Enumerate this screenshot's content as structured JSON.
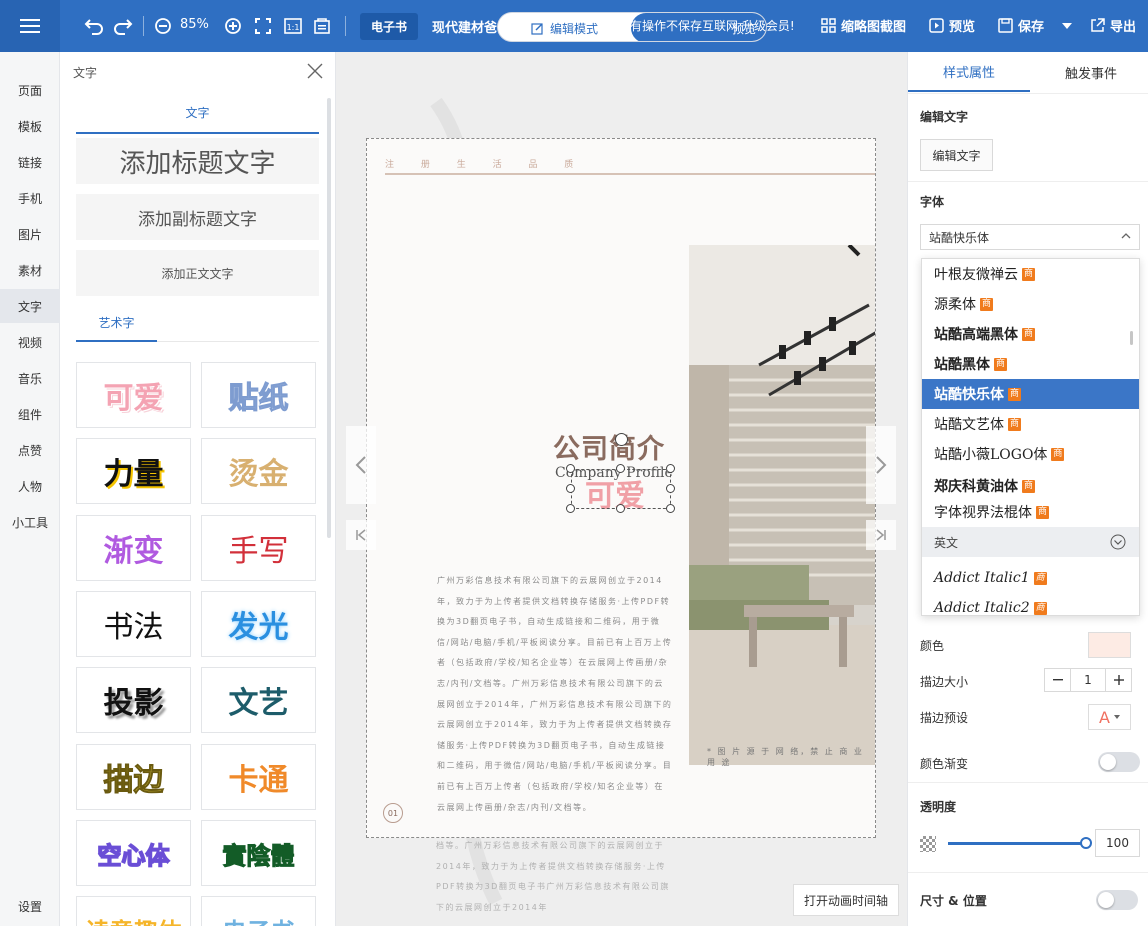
{
  "topbar": {
    "zoom": "85%",
    "tab_ebook": "电子书",
    "doc_title": "现代建材爸",
    "pill_left": "编辑模式",
    "pill_right": "预览",
    "promo": "有操作不保存互联网 升级会员!",
    "thumb_action": "缩略图截图",
    "preview_action": "预览",
    "save_action": "保存",
    "export_action": "导出"
  },
  "leftnav": {
    "items": [
      "页面",
      "模板",
      "链接",
      "手机",
      "图片",
      "素材",
      "文字",
      "视频",
      "音乐",
      "组件",
      "点赞",
      "人物",
      "小工具"
    ],
    "settings": "设置"
  },
  "textpanel": {
    "title": "文字",
    "tab": "文字",
    "add_title": "添加标题文字",
    "add_subtitle": "添加副标题文字",
    "add_body": "添加正文文字",
    "art_tab": "艺术字",
    "tiles": [
      "可爱",
      "贴纸",
      "力量",
      "烫金",
      "渐变",
      "手写",
      "书法",
      "发光",
      "投影",
      "文艺",
      "描边",
      "卡通",
      "空心体",
      "實陰體",
      "读意趣体",
      "电子书"
    ]
  },
  "canvas": {
    "page_header": "注 册 生 活 品 质",
    "company_title": "公司简介",
    "company_sub": "Company Profile",
    "selected_text": "可爱",
    "body_text": "广州万彩信息技术有限公司旗下的云展网创立于2014年，致力于为上传者提供文档转换存储服务·上传PDF转换为3D翻页电子书，自动生成链接和二维码，用于微信/网站/电脑/手机/平板阅读分享。目前已有上百万上传者（包括政府/学校/知名企业等）在云展网上传画册/杂志/内刊/文档等。广州万彩信息技术有限公司旗下的云展网创立于2014年，广州万彩信息技术有限公司旗下的云展网创立于2014年，致力于为上传者提供文档转换存储服务·上传PDF转换为3D翻页电子书，自动生成链接和二维码，用于微信/网站/电脑/手机/平板阅读分享。目前已有上百万上传者（包括政府/学校/知名企业等）在云展网上传画册/杂志/内刊/文档等。",
    "body_text_overflow": "档等。广州万彩信息技术有限公司旗下的云展网创立于2014年，致力于为上传者提供文档转换存储服务·上传PDF转换为3D翻页电子书广州万彩信息技术有限公司旗下的云展网创立于2014年",
    "photo_caption": "* 图 片 源 于 网 络，禁 止 商 业 用 途",
    "page_number": "01",
    "timeline_button": "打开动画时间轴"
  },
  "rightpanel": {
    "tab_style": "样式属性",
    "tab_events": "触发事件",
    "edit_text_label": "编辑文字",
    "edit_text_button": "编辑文字",
    "font_label": "字体",
    "font_selected": "站酷快乐体",
    "font_options": [
      "叶根友微禅云",
      "源柔体",
      "站酷高端黑体",
      "站酷黑体",
      "站酷快乐体",
      "站酷文艺体",
      "站酷小薇LOGO体",
      "郑庆科黄油体",
      "字体视界法棍体"
    ],
    "font_group_en": "英文",
    "font_options_en": [
      "Addict Italic1",
      "Addict Italic2"
    ],
    "badge": "商",
    "color_label": "颜色",
    "stroke_size_label": "描边大小",
    "stroke_size_value": "1",
    "stroke_preset_label": "描边预设",
    "stroke_preset_glyph": "A",
    "gradient_label": "颜色渐变",
    "opacity_label": "透明度",
    "opacity_value": "100",
    "size_pos_label": "尺寸 & 位置"
  },
  "colors": {
    "primary": "#2f6fc2",
    "badge": "#f07b1d",
    "selected_row": "#3b76c7"
  }
}
